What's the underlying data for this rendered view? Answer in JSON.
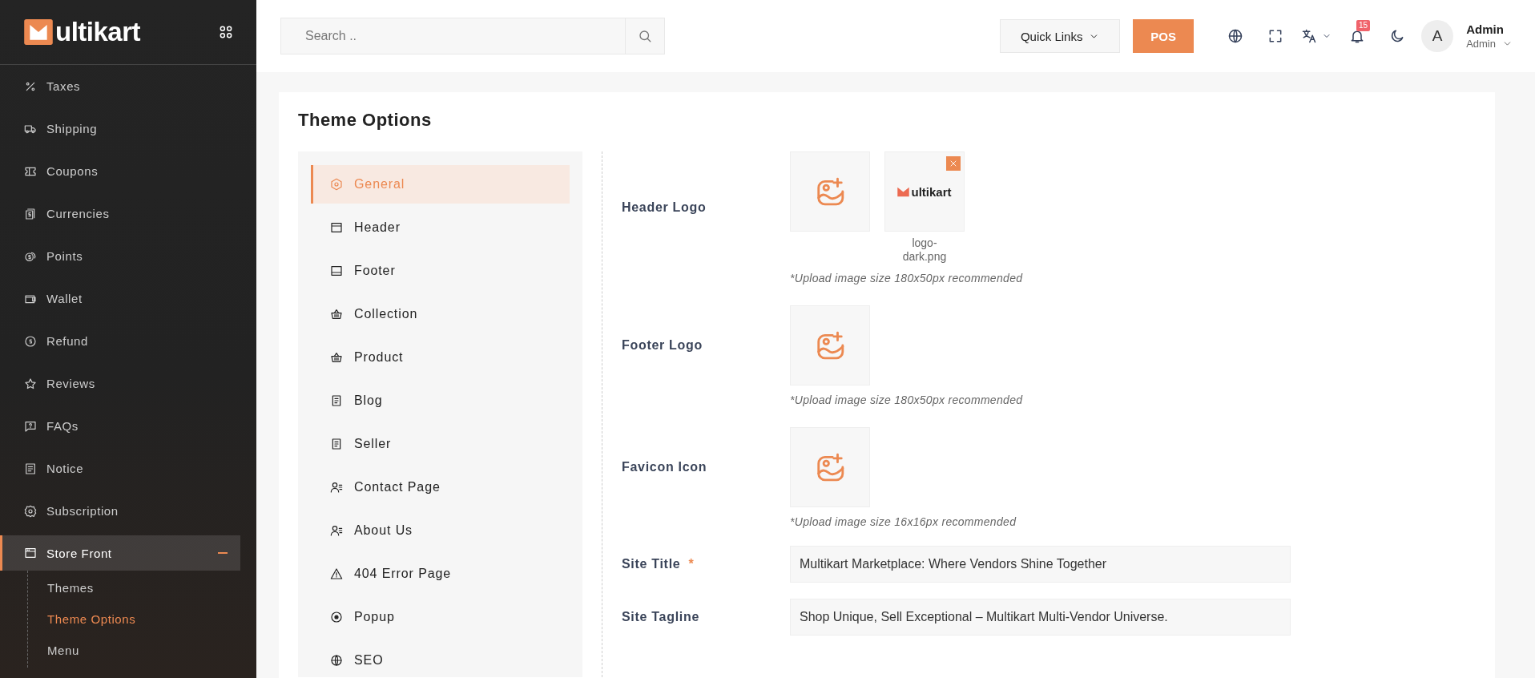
{
  "sidebar": {
    "brand": "ultikart",
    "items": [
      {
        "label": "Taxes",
        "selected": false
      },
      {
        "label": "Shipping",
        "selected": false
      },
      {
        "label": "Coupons",
        "selected": false
      },
      {
        "label": "Currencies",
        "selected": false
      },
      {
        "label": "Points",
        "selected": false
      },
      {
        "label": "Wallet",
        "selected": false
      },
      {
        "label": "Refund",
        "selected": false
      },
      {
        "label": "Reviews",
        "selected": false
      },
      {
        "label": "FAQs",
        "selected": false
      },
      {
        "label": "Notice",
        "selected": false
      },
      {
        "label": "Subscription",
        "selected": false
      },
      {
        "label": "Store Front",
        "selected": true,
        "expanded": true,
        "children": [
          {
            "label": "Themes",
            "selected": false
          },
          {
            "label": "Theme Options",
            "selected": true
          },
          {
            "label": "Menu",
            "selected": false
          }
        ]
      }
    ]
  },
  "header": {
    "search": {
      "placeholder": "Search .."
    },
    "quick_links": "Quick Links",
    "pos": "POS",
    "notifications": {
      "count": "15"
    },
    "user": {
      "avatar": "A",
      "name": "Admin",
      "role": "Admin"
    }
  },
  "page": {
    "title": "Theme Options",
    "tabs": [
      {
        "label": "General",
        "selected": true
      },
      {
        "label": "Header",
        "selected": false
      },
      {
        "label": "Footer",
        "selected": false
      },
      {
        "label": "Collection",
        "selected": false
      },
      {
        "label": "Product",
        "selected": false
      },
      {
        "label": "Blog",
        "selected": false
      },
      {
        "label": "Seller",
        "selected": false
      },
      {
        "label": "Contact Page",
        "selected": false
      },
      {
        "label": "About Us",
        "selected": false
      },
      {
        "label": "404 Error Page",
        "selected": false
      },
      {
        "label": "Popup",
        "selected": false
      },
      {
        "label": "SEO",
        "selected": false
      }
    ],
    "fields": [
      {
        "kind": "upload",
        "label": "Header Logo",
        "images": [
          {
            "filename": "logo-dark.png",
            "preview": "ultikart",
            "removable": true
          }
        ],
        "hint": "*Upload image size 180x50px recommended"
      },
      {
        "kind": "upload",
        "label": "Footer Logo",
        "hint": "*Upload image size 180x50px recommended"
      },
      {
        "kind": "upload",
        "label": "Favicon Icon",
        "hint": "*Upload image size 16x16px recommended"
      },
      {
        "kind": "text",
        "label": "Site Title",
        "required_mark": "*",
        "value": "Multikart Marketplace: Where Vendors Shine Together"
      },
      {
        "kind": "text",
        "label": "Site Tagline",
        "value": "Shop Unique, Sell Exceptional – Multikart Multi-Vendor Universe."
      }
    ]
  }
}
